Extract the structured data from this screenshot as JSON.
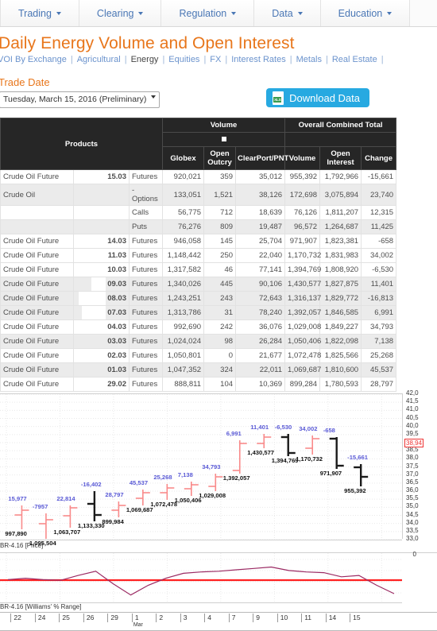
{
  "nav": {
    "items": [
      {
        "label": "Trading",
        "icon": "chevron-down-icon"
      },
      {
        "label": "Clearing",
        "icon": "chevron-down-icon"
      },
      {
        "label": "Regulation",
        "icon": "chevron-down-icon"
      },
      {
        "label": "Data",
        "icon": "chevron-down-icon"
      },
      {
        "label": "Education",
        "icon": "chevron-down-icon"
      }
    ]
  },
  "header": {
    "title": "Daily Energy Volume and Open Interest",
    "breadcrumbs": [
      {
        "label": "VOI By Exchange",
        "current": false
      },
      {
        "label": "Agricultural",
        "current": false
      },
      {
        "label": "Energy",
        "current": true
      },
      {
        "label": "Equities",
        "current": false
      },
      {
        "label": "FX",
        "current": false
      },
      {
        "label": "Interest Rates",
        "current": false
      },
      {
        "label": "Metals",
        "current": false
      },
      {
        "label": "Real Estate",
        "current": false
      },
      {
        "label": "",
        "current": false
      }
    ],
    "separator": "|"
  },
  "controls": {
    "trade_date_label": "Trade Date",
    "trade_date_value": "Tuesday, March 15, 2016 (Preliminary)",
    "download_label": "Download Data",
    "download_icon": "xls-file-icon",
    "dropdown_icon": "chevron-down-icon"
  },
  "table": {
    "group_headers": [
      {
        "label": "Products",
        "span": 3
      },
      {
        "label": "Volume",
        "span": 3
      },
      {
        "label": "Overall Combined Total",
        "span": 3
      }
    ],
    "sub_header_marker": "",
    "columns": [
      "Globex",
      "Open Outcry",
      "ClearPort/PNT",
      "Volume",
      "Open Interest",
      "Change"
    ],
    "rows": [
      {
        "product": "Crude Oil Future",
        "date": "15.03",
        "type": "Futures",
        "globex": "920,021",
        "outcry": "359",
        "clearport": "35,012",
        "volume": "955,392",
        "oi": "1,792,966",
        "change": "-15,661",
        "alt": false
      },
      {
        "product": "Crude Oil",
        "date": "",
        "type": "- Options",
        "globex": "133,051",
        "outcry": "1,521",
        "clearport": "38,126",
        "volume": "172,698",
        "oi": "3,075,894",
        "change": "23,740",
        "alt": true
      },
      {
        "product": "",
        "date": "",
        "type": "Calls",
        "globex": "56,775",
        "outcry": "712",
        "clearport": "18,639",
        "volume": "76,126",
        "oi": "1,811,207",
        "change": "12,315",
        "alt": false
      },
      {
        "product": "",
        "date": "",
        "type": "Puts",
        "globex": "76,276",
        "outcry": "809",
        "clearport": "19,487",
        "volume": "96,572",
        "oi": "1,264,687",
        "change": "11,425",
        "alt": true
      },
      {
        "product": "Crude Oil Future",
        "date": "14.03",
        "type": "Futures",
        "globex": "946,058",
        "outcry": "145",
        "clearport": "25,704",
        "volume": "971,907",
        "oi": "1,823,381",
        "change": "-658",
        "alt": false
      },
      {
        "product": "Crude Oil Future",
        "date": "11.03",
        "type": "Futures",
        "globex": "1,148,442",
        "outcry": "250",
        "clearport": "22,040",
        "volume": "1,170,732",
        "oi": "1,831,983",
        "change": "34,002",
        "alt": false
      },
      {
        "product": "Crude Oil Future",
        "date": "10.03",
        "type": "Futures",
        "globex": "1,317,582",
        "outcry": "46",
        "clearport": "77,141",
        "volume": "1,394,769",
        "oi": "1,808,920",
        "change": "-6,530",
        "alt": false
      },
      {
        "product": "Crude Oil Future",
        "date": "09.03",
        "type": "Futures",
        "globex": "1,340,026",
        "outcry": "445",
        "clearport": "90,106",
        "volume": "1,430,577",
        "oi": "1,827,875",
        "change": "11,401",
        "alt": true
      },
      {
        "product": "Crude Oil Future",
        "date": "08.03",
        "type": "Futures",
        "globex": "1,243,251",
        "outcry": "243",
        "clearport": "72,643",
        "volume": "1,316,137",
        "oi": "1,829,772",
        "change": "-16,813",
        "alt": true
      },
      {
        "product": "Crude Oil Future",
        "date": "07.03",
        "type": "Futures",
        "globex": "1,313,786",
        "outcry": "31",
        "clearport": "78,240",
        "volume": "1,392,057",
        "oi": "1,846,585",
        "change": "6,991",
        "alt": true
      },
      {
        "product": "Crude Oil Future",
        "date": "04.03",
        "type": "Futures",
        "globex": "992,690",
        "outcry": "242",
        "clearport": "36,076",
        "volume": "1,029,008",
        "oi": "1,849,227",
        "change": "34,793",
        "alt": false
      },
      {
        "product": "Crude Oil Future",
        "date": "03.03",
        "type": "Futures",
        "globex": "1,024,024",
        "outcry": "98",
        "clearport": "26,284",
        "volume": "1,050,406",
        "oi": "1,822,098",
        "change": "7,138",
        "alt": true
      },
      {
        "product": "Crude Oil Future",
        "date": "02.03",
        "type": "Futures",
        "globex": "1,050,801",
        "outcry": "0",
        "clearport": "21,677",
        "volume": "1,072,478",
        "oi": "1,825,566",
        "change": "25,268",
        "alt": false
      },
      {
        "product": "Crude Oil Future",
        "date": "01.03",
        "type": "Futures",
        "globex": "1,047,352",
        "outcry": "324",
        "clearport": "22,011",
        "volume": "1,069,687",
        "oi": "1,810,600",
        "change": "45,537",
        "alt": true
      },
      {
        "product": "Crude Oil Future",
        "date": "29.02",
        "type": "Futures",
        "globex": "888,811",
        "outcry": "104",
        "clearport": "10,369",
        "volume": "899,284",
        "oi": "1,780,593",
        "change": "28,797",
        "alt": false
      }
    ]
  },
  "chart_data": {
    "type": "bar",
    "title": "BR-4.16 [Price]",
    "subtitle": "BR-4.16 [Williams' % Range]",
    "xlabel": "Mar",
    "ylabel": "",
    "ylim": [
      33.0,
      42.0
    ],
    "ytick_step": 0.5,
    "yticks": [
      "42,0",
      "41,5",
      "41,0",
      "40,5",
      "40,0",
      "39,5",
      "39,0",
      "38,5",
      "38,0",
      "37,5",
      "37,0",
      "36,5",
      "36,0",
      "35,5",
      "35,0",
      "34,5",
      "34,0",
      "33,5",
      "33,0"
    ],
    "current_price_marker": "38,94",
    "grid": true,
    "zero_label": "0",
    "x_ticks": [
      "22",
      "24",
      "25",
      "26",
      "29",
      "1",
      "2",
      "3",
      "4",
      "7",
      "9",
      "10",
      "11",
      "14",
      "15"
    ],
    "bars": [
      {
        "x": "22",
        "volume": "997,890",
        "change": "15,977",
        "dir": "up"
      },
      {
        "x": "24",
        "volume": "1,095,504",
        "change": "-7957",
        "dir": "up"
      },
      {
        "x": "25",
        "volume": "1,063,707",
        "change": "22,814",
        "dir": "up"
      },
      {
        "x": "26",
        "volume": "1,133,330",
        "change": "-16,402",
        "dir": "down"
      },
      {
        "x": "29",
        "volume": "899,984",
        "change": "28,797",
        "dir": "up"
      },
      {
        "x": "1",
        "volume": "1,069,687",
        "change": "45,537",
        "dir": "up"
      },
      {
        "x": "2",
        "volume": "1,072,478",
        "change": "25,268",
        "dir": "up"
      },
      {
        "x": "3",
        "volume": "1,050,406",
        "change": "7,138",
        "dir": "up"
      },
      {
        "x": "4",
        "volume": "1,029,008",
        "change": "34,793",
        "dir": "up"
      },
      {
        "x": "7",
        "volume": "1,392,057",
        "change": "6,991",
        "dir": "up"
      },
      {
        "x": "9",
        "volume": "1,430,577",
        "change": "11,401",
        "dir": "up"
      },
      {
        "x": "10",
        "volume": "1,394,769",
        "change": "-6,530",
        "dir": "down"
      },
      {
        "x": "11",
        "volume": "1,170,732",
        "change": "34,002",
        "dir": "up"
      },
      {
        "x": "14",
        "volume": "971,907",
        "change": "-658",
        "dir": "down"
      },
      {
        "x": "15",
        "volume": "955,392",
        "change": "-15,661",
        "dir": "down"
      }
    ],
    "williams_series": {
      "name": "Williams' % Range",
      "values": [
        -22,
        -20,
        -22,
        -23,
        -16,
        -10,
        -28,
        -44,
        -30,
        -20,
        -13,
        -11,
        -10,
        -8,
        -6,
        -4,
        -9,
        -11,
        -12,
        -18,
        -16,
        -30,
        -42
      ]
    },
    "colors": {
      "up": "#f98a8a",
      "down": "#1a1a1a",
      "change_label": "#5a5ad6",
      "volume_label": "#111111",
      "williams_line": "#9b2a63",
      "zero_line": "#ff2222",
      "price_highlight": "#e33333"
    }
  }
}
